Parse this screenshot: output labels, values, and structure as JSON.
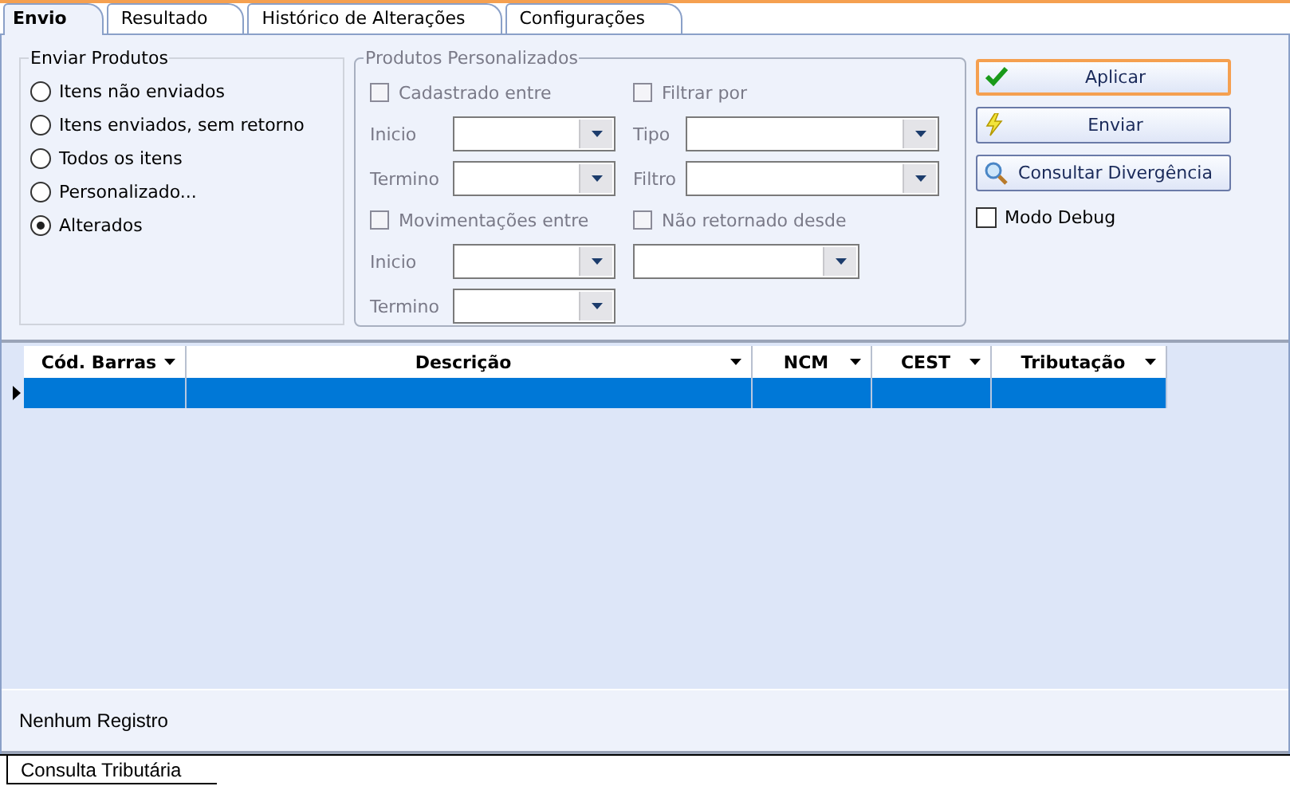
{
  "tabs": [
    {
      "label": "Envio",
      "selected": true
    },
    {
      "label": "Resultado",
      "selected": false
    },
    {
      "label": "Histórico de Alterações",
      "selected": false
    },
    {
      "label": "Configurações",
      "selected": false
    }
  ],
  "send_group": {
    "title": "Enviar Produtos",
    "options": [
      {
        "label": "Itens não enviados",
        "selected": false
      },
      {
        "label": "Itens enviados, sem retorno",
        "selected": false
      },
      {
        "label": "Todos os itens",
        "selected": false
      },
      {
        "label": "Personalizado...",
        "selected": false
      },
      {
        "label": "Alterados",
        "selected": true
      }
    ]
  },
  "custom_group": {
    "title": "Produtos Personalizados",
    "disabled": true,
    "columns": [
      [
        {
          "kind": "checkbox",
          "label": "Cadastrado entre",
          "checked": false
        },
        {
          "kind": "combo",
          "label": "Inicio"
        },
        {
          "kind": "combo",
          "label": "Termino"
        },
        {
          "kind": "checkbox",
          "label": "Movimentações entre",
          "checked": false
        },
        {
          "kind": "combo",
          "label": "Inicio"
        },
        {
          "kind": "combo",
          "label": "Termino"
        }
      ],
      [
        {
          "kind": "checkbox",
          "label": "Filtrar por",
          "checked": false
        },
        {
          "kind": "combo",
          "label": "Tipo"
        },
        {
          "kind": "combo",
          "label": "Filtro"
        },
        {
          "kind": "checkbox",
          "label": "Não retornado desde",
          "checked": false
        },
        {
          "kind": "combo"
        }
      ]
    ]
  },
  "buttons": [
    {
      "label": "Aplicar",
      "kind": "check",
      "focused": true
    },
    {
      "label": "Enviar",
      "kind": "bolt",
      "focused": false
    },
    {
      "label": "Consultar Divergência",
      "kind": "search",
      "focused": false
    }
  ],
  "debug_checkbox": {
    "label": "Modo Debug",
    "checked": false
  },
  "table": {
    "columns": [
      "Cód. Barras",
      "Descrição",
      "NCM",
      "CEST",
      "Tributação"
    ],
    "rows": [
      {
        "selected": true
      }
    ]
  },
  "status_text": "Nenhum Registro",
  "bottom_tabs": [
    {
      "label": "Consulta Tributária",
      "selected": true
    }
  ]
}
